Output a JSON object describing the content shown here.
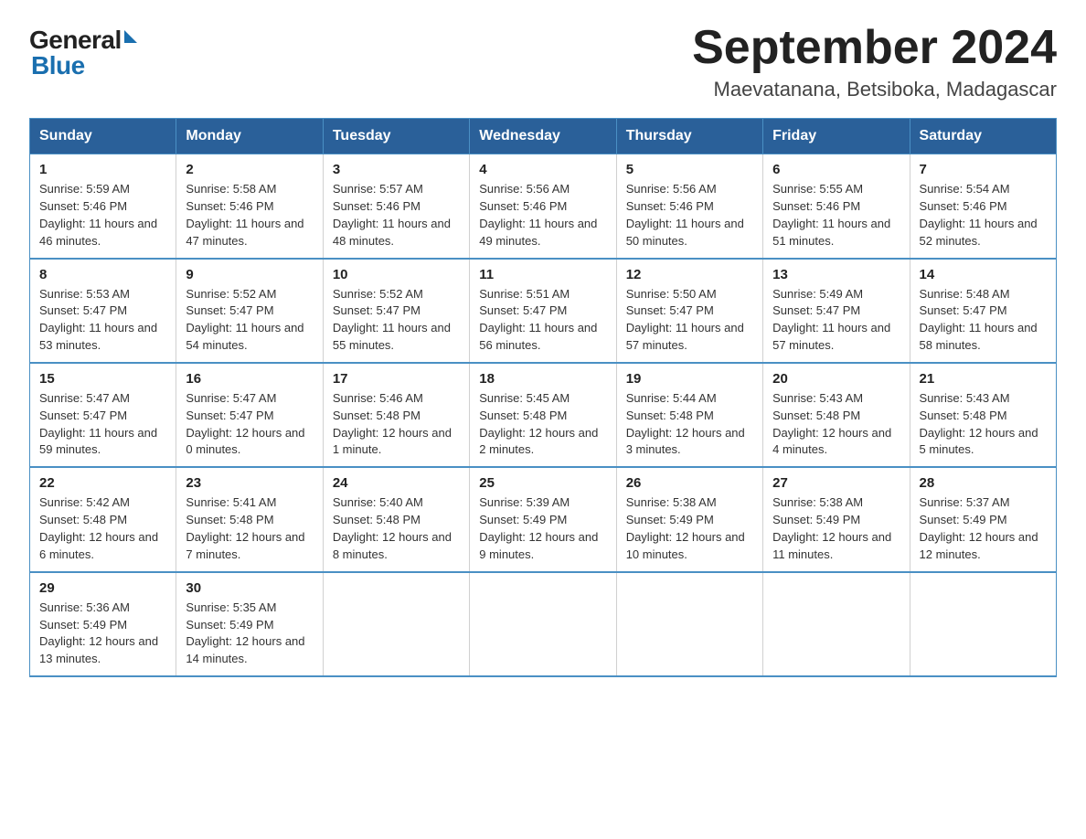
{
  "logo": {
    "text_general": "General",
    "triangle": "▶",
    "text_blue": "Blue"
  },
  "title": "September 2024",
  "subtitle": "Maevatanana, Betsiboka, Madagascar",
  "days_of_week": [
    "Sunday",
    "Monday",
    "Tuesday",
    "Wednesday",
    "Thursday",
    "Friday",
    "Saturday"
  ],
  "weeks": [
    [
      {
        "day": "1",
        "sunrise": "5:59 AM",
        "sunset": "5:46 PM",
        "daylight": "11 hours and 46 minutes."
      },
      {
        "day": "2",
        "sunrise": "5:58 AM",
        "sunset": "5:46 PM",
        "daylight": "11 hours and 47 minutes."
      },
      {
        "day": "3",
        "sunrise": "5:57 AM",
        "sunset": "5:46 PM",
        "daylight": "11 hours and 48 minutes."
      },
      {
        "day": "4",
        "sunrise": "5:56 AM",
        "sunset": "5:46 PM",
        "daylight": "11 hours and 49 minutes."
      },
      {
        "day": "5",
        "sunrise": "5:56 AM",
        "sunset": "5:46 PM",
        "daylight": "11 hours and 50 minutes."
      },
      {
        "day": "6",
        "sunrise": "5:55 AM",
        "sunset": "5:46 PM",
        "daylight": "11 hours and 51 minutes."
      },
      {
        "day": "7",
        "sunrise": "5:54 AM",
        "sunset": "5:46 PM",
        "daylight": "11 hours and 52 minutes."
      }
    ],
    [
      {
        "day": "8",
        "sunrise": "5:53 AM",
        "sunset": "5:47 PM",
        "daylight": "11 hours and 53 minutes."
      },
      {
        "day": "9",
        "sunrise": "5:52 AM",
        "sunset": "5:47 PM",
        "daylight": "11 hours and 54 minutes."
      },
      {
        "day": "10",
        "sunrise": "5:52 AM",
        "sunset": "5:47 PM",
        "daylight": "11 hours and 55 minutes."
      },
      {
        "day": "11",
        "sunrise": "5:51 AM",
        "sunset": "5:47 PM",
        "daylight": "11 hours and 56 minutes."
      },
      {
        "day": "12",
        "sunrise": "5:50 AM",
        "sunset": "5:47 PM",
        "daylight": "11 hours and 57 minutes."
      },
      {
        "day": "13",
        "sunrise": "5:49 AM",
        "sunset": "5:47 PM",
        "daylight": "11 hours and 57 minutes."
      },
      {
        "day": "14",
        "sunrise": "5:48 AM",
        "sunset": "5:47 PM",
        "daylight": "11 hours and 58 minutes."
      }
    ],
    [
      {
        "day": "15",
        "sunrise": "5:47 AM",
        "sunset": "5:47 PM",
        "daylight": "11 hours and 59 minutes."
      },
      {
        "day": "16",
        "sunrise": "5:47 AM",
        "sunset": "5:47 PM",
        "daylight": "12 hours and 0 minutes."
      },
      {
        "day": "17",
        "sunrise": "5:46 AM",
        "sunset": "5:48 PM",
        "daylight": "12 hours and 1 minute."
      },
      {
        "day": "18",
        "sunrise": "5:45 AM",
        "sunset": "5:48 PM",
        "daylight": "12 hours and 2 minutes."
      },
      {
        "day": "19",
        "sunrise": "5:44 AM",
        "sunset": "5:48 PM",
        "daylight": "12 hours and 3 minutes."
      },
      {
        "day": "20",
        "sunrise": "5:43 AM",
        "sunset": "5:48 PM",
        "daylight": "12 hours and 4 minutes."
      },
      {
        "day": "21",
        "sunrise": "5:43 AM",
        "sunset": "5:48 PM",
        "daylight": "12 hours and 5 minutes."
      }
    ],
    [
      {
        "day": "22",
        "sunrise": "5:42 AM",
        "sunset": "5:48 PM",
        "daylight": "12 hours and 6 minutes."
      },
      {
        "day": "23",
        "sunrise": "5:41 AM",
        "sunset": "5:48 PM",
        "daylight": "12 hours and 7 minutes."
      },
      {
        "day": "24",
        "sunrise": "5:40 AM",
        "sunset": "5:48 PM",
        "daylight": "12 hours and 8 minutes."
      },
      {
        "day": "25",
        "sunrise": "5:39 AM",
        "sunset": "5:49 PM",
        "daylight": "12 hours and 9 minutes."
      },
      {
        "day": "26",
        "sunrise": "5:38 AM",
        "sunset": "5:49 PM",
        "daylight": "12 hours and 10 minutes."
      },
      {
        "day": "27",
        "sunrise": "5:38 AM",
        "sunset": "5:49 PM",
        "daylight": "12 hours and 11 minutes."
      },
      {
        "day": "28",
        "sunrise": "5:37 AM",
        "sunset": "5:49 PM",
        "daylight": "12 hours and 12 minutes."
      }
    ],
    [
      {
        "day": "29",
        "sunrise": "5:36 AM",
        "sunset": "5:49 PM",
        "daylight": "12 hours and 13 minutes."
      },
      {
        "day": "30",
        "sunrise": "5:35 AM",
        "sunset": "5:49 PM",
        "daylight": "12 hours and 14 minutes."
      },
      null,
      null,
      null,
      null,
      null
    ]
  ]
}
